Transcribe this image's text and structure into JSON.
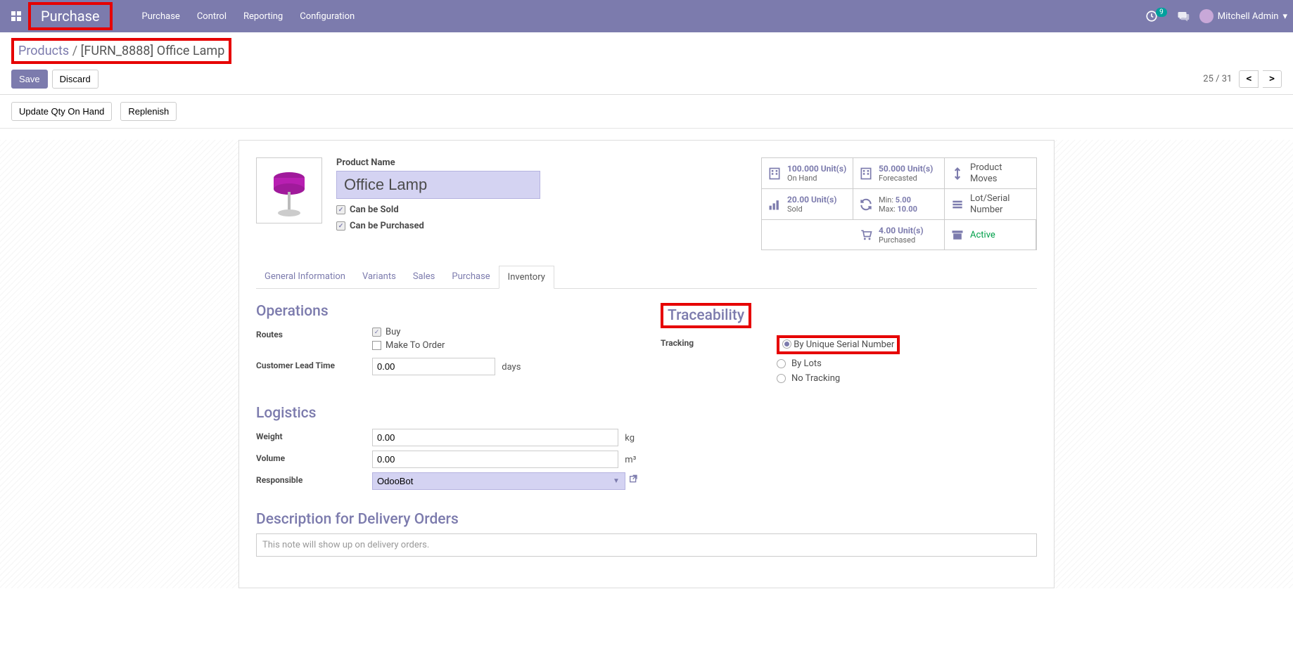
{
  "navbar": {
    "brand": "Purchase",
    "menu": [
      "Purchase",
      "Control",
      "Reporting",
      "Configuration"
    ],
    "notif_count": "9",
    "user": "Mitchell Admin"
  },
  "breadcrumb": {
    "root": "Products",
    "sep": "/",
    "active": "[FURN_8888] Office Lamp"
  },
  "buttons": {
    "save": "Save",
    "discard": "Discard",
    "update_qty": "Update Qty On Hand",
    "replenish": "Replenish"
  },
  "pager": {
    "text": "25 / 31"
  },
  "product": {
    "name_label": "Product Name",
    "name": "Office Lamp",
    "can_be_sold": "Can be Sold",
    "can_be_purchased": "Can be Purchased"
  },
  "stats": {
    "onhand_val": "100.000 Unit(s)",
    "onhand_lbl": "On Hand",
    "forecast_val": "50.000 Unit(s)",
    "forecast_lbl": "Forecasted",
    "moves_lbl": "Product Moves",
    "sold_val": "20.00 Unit(s)",
    "sold_lbl": "Sold",
    "min_lbl": "Min:",
    "min_val": "5.00",
    "max_lbl": "Max:",
    "max_val": "10.00",
    "lot_lbl": "Lot/Serial Number",
    "purch_val": "4.00 Unit(s)",
    "purch_lbl": "Purchased",
    "active_lbl": "Active"
  },
  "tabs": [
    "General Information",
    "Variants",
    "Sales",
    "Purchase",
    "Inventory"
  ],
  "operations": {
    "heading": "Operations",
    "routes_lbl": "Routes",
    "route_buy": "Buy",
    "route_mto": "Make To Order",
    "lead_lbl": "Customer Lead Time",
    "lead_val": "0.00",
    "lead_unit": "days"
  },
  "traceability": {
    "heading": "Traceability",
    "tracking_lbl": "Tracking",
    "opts": [
      "By Unique Serial Number",
      "By Lots",
      "No Tracking"
    ]
  },
  "logistics": {
    "heading": "Logistics",
    "weight_lbl": "Weight",
    "weight_val": "0.00",
    "weight_unit": "kg",
    "volume_lbl": "Volume",
    "volume_val": "0.00",
    "volume_unit": "m³",
    "resp_lbl": "Responsible",
    "resp_val": "OdooBot"
  },
  "description": {
    "heading": "Description for Delivery Orders",
    "placeholder": "This note will show up on delivery orders."
  }
}
